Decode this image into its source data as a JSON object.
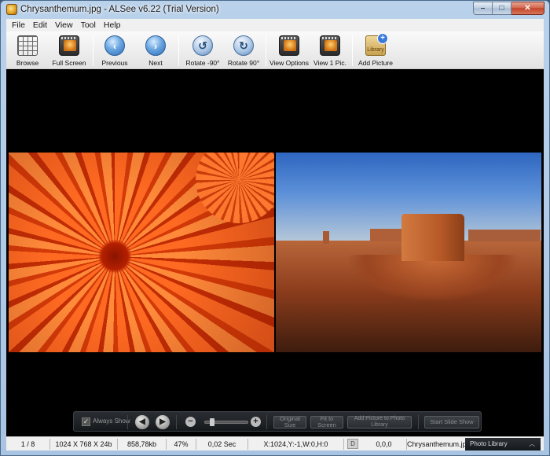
{
  "window": {
    "title": "Chrysanthemum.jpg - ALSee v6.22 (Trial Version)",
    "caption_buttons": {
      "minimize": "–",
      "maximize": "□",
      "close": "✕"
    }
  },
  "menu": [
    "File",
    "Edit",
    "View",
    "Tool",
    "Help"
  ],
  "toolbar": {
    "browse": "Browse",
    "full_screen": "Full Screen",
    "previous": "Previous",
    "next": "Next",
    "rotate_ccw": "Rotate -90°",
    "rotate_cw": "Rotate 90°",
    "view_options": "View Options",
    "view_one_pic": "View 1 Pic.",
    "add_picture": "Add Picture",
    "library_icon_text": "Library"
  },
  "controls": {
    "always_show": "Always Show",
    "always_show_checked": true,
    "prev_glyph": "◀",
    "next_glyph": "▶",
    "zoom_out_glyph": "−",
    "zoom_in_glyph": "+",
    "original_size": "Original Size",
    "fit_to_screen": "Fit to Screen",
    "add_to_library": "Add Picture to Photo Library",
    "start_slide_show": "Start Slide Show"
  },
  "status": {
    "index": "1 / 8",
    "dimensions": "1024 X 768 X 24b",
    "file_size": "858,78kb",
    "zoom": "47%",
    "load_time": "0,02 Sec",
    "cursor_info": "X:1024,Y:-1,W:0,H:0",
    "d_button": "D",
    "coords": "0,0,0",
    "filename": "Chrysanthemum.jpg",
    "photo_library": "Photo Library"
  },
  "colors": {
    "title_bar": "#b9d1ea",
    "viewer_background": "#000000",
    "control_bar": "#1e2226",
    "close_button": "#c2452a"
  }
}
